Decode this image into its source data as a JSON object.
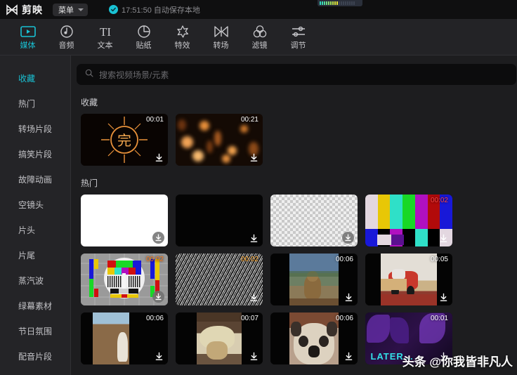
{
  "titlebar": {
    "logo_text": "剪映",
    "logo_icon": "jianying-logo-icon",
    "menu_label": "菜单",
    "caret_icon": "chevron-down-icon",
    "check_icon": "check-circle-icon",
    "autosave_text": "17:51:50 自动保存本地",
    "level_meter_icon": "audio-level-meter-icon"
  },
  "toolbar": {
    "tabs": [
      {
        "label": "媒体",
        "icon": "media-play-icon",
        "active": true
      },
      {
        "label": "音频",
        "icon": "audio-note-icon",
        "active": false
      },
      {
        "label": "文本",
        "icon": "text-ti-icon",
        "active": false
      },
      {
        "label": "贴纸",
        "icon": "sticker-icon",
        "active": false
      },
      {
        "label": "特效",
        "icon": "effects-star-icon",
        "active": false
      },
      {
        "label": "转场",
        "icon": "transition-bowtie-icon",
        "active": false
      },
      {
        "label": "滤镜",
        "icon": "filter-circles-icon",
        "active": false
      },
      {
        "label": "调节",
        "icon": "adjust-sliders-icon",
        "active": false
      }
    ]
  },
  "sidebar": {
    "items": [
      {
        "label": "收藏",
        "active": true
      },
      {
        "label": "热门",
        "active": false
      },
      {
        "label": "转场片段",
        "active": false
      },
      {
        "label": "搞笑片段",
        "active": false
      },
      {
        "label": "故障动画",
        "active": false
      },
      {
        "label": "空镜头",
        "active": false
      },
      {
        "label": "片头",
        "active": false
      },
      {
        "label": "片尾",
        "active": false
      },
      {
        "label": "蒸汽波",
        "active": false
      },
      {
        "label": "绿幕素材",
        "active": false
      },
      {
        "label": "节日氛围",
        "active": false
      },
      {
        "label": "配音片段",
        "active": false
      }
    ]
  },
  "search": {
    "icon": "search-icon",
    "placeholder": "搜索视频场景/元素",
    "value": ""
  },
  "sections": [
    {
      "title": "收藏",
      "items": [
        {
          "duration": "00:01",
          "art": "sun-wan",
          "download_icon": "download-icon",
          "download_style": "plain"
        },
        {
          "duration": "00:21",
          "art": "bokeh",
          "download_icon": "download-icon",
          "download_style": "plain"
        }
      ]
    },
    {
      "title": "热门",
      "items": [
        {
          "duration": "",
          "art": "white",
          "download_icon": "download-icon",
          "download_style": "circle"
        },
        {
          "duration": "",
          "art": "black",
          "download_icon": "download-icon",
          "download_style": "plain"
        },
        {
          "duration": "",
          "art": "alpha",
          "download_icon": "download-icon",
          "download_style": "circle"
        },
        {
          "duration": "00:02",
          "art": "colorbars",
          "download_icon": "download-icon",
          "download_style": "plain"
        },
        {
          "duration": "00:02",
          "art": "smpte",
          "download_icon": "download-icon",
          "download_style": "circle"
        },
        {
          "duration": "00:02",
          "art": "noise",
          "download_icon": "download-icon",
          "download_style": "plain"
        },
        {
          "duration": "00:06",
          "art": "marmot",
          "download_icon": "download-icon",
          "download_style": "plain"
        },
        {
          "duration": "00:05",
          "art": "car",
          "download_icon": "download-icon",
          "download_style": "plain"
        },
        {
          "duration": "00:06",
          "art": "beach",
          "download_icon": "download-icon",
          "download_style": "plain"
        },
        {
          "duration": "00:07",
          "art": "dog1",
          "download_icon": "download-icon",
          "download_style": "plain"
        },
        {
          "duration": "00:06",
          "art": "pug",
          "download_icon": "download-icon",
          "download_style": "plain"
        },
        {
          "duration": "00:01",
          "art": "purple",
          "download_icon": "download-icon",
          "download_style": "plain"
        }
      ]
    }
  ],
  "watermark": {
    "text": "头条 @你我皆非凡人"
  },
  "colors": {
    "accent": "#19c2d4",
    "titlebar_bg": "#0f0f10",
    "toolbar_bg": "#232326",
    "sidebar_bg": "#242427",
    "main_bg": "#1d1d1f",
    "search_bg": "#0c0c0d"
  }
}
